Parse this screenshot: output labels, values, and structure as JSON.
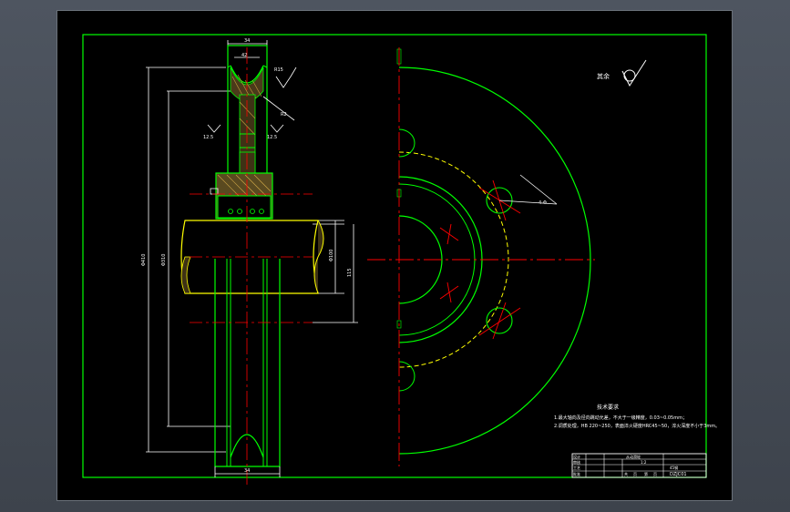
{
  "colors": {
    "background": "#000000",
    "border": "#00ff00",
    "outline": "#ffffff",
    "center_line": "#ff0000",
    "hidden_line": "#ffff00",
    "dimension": "#ffffff"
  },
  "drawing": {
    "dims": {
      "top_width": "34",
      "groove_width": "42",
      "groove_radius": "R15",
      "fillet": "R2",
      "roughness_a": "12.5",
      "roughness_b": "12.5",
      "overall_dia": "Φ410",
      "dia_310": "Φ310",
      "bore": "Φ100",
      "hub": "115",
      "bottom_width": "34",
      "holes": "4-Φ"
    },
    "roughness_note_label": "其余",
    "tech_req": {
      "title": "技术要求",
      "line1": "1.最大轴向及径向跳动允差，不大于一级精度，0.03~0.05mm；",
      "line2": "2.调质处理，HB 220~250，表面淬火硬度HRC45~50，淬火深度不小于3mm。"
    },
    "title_block": {
      "part_name": "从动滑轮",
      "scale": "1:2",
      "material": "45钢",
      "drawing_no": "DZJC01",
      "row_labels": [
        "设计",
        "审核",
        "工艺",
        "批准"
      ],
      "sheet_cells": [
        "共",
        "页",
        "第",
        "页"
      ]
    }
  }
}
